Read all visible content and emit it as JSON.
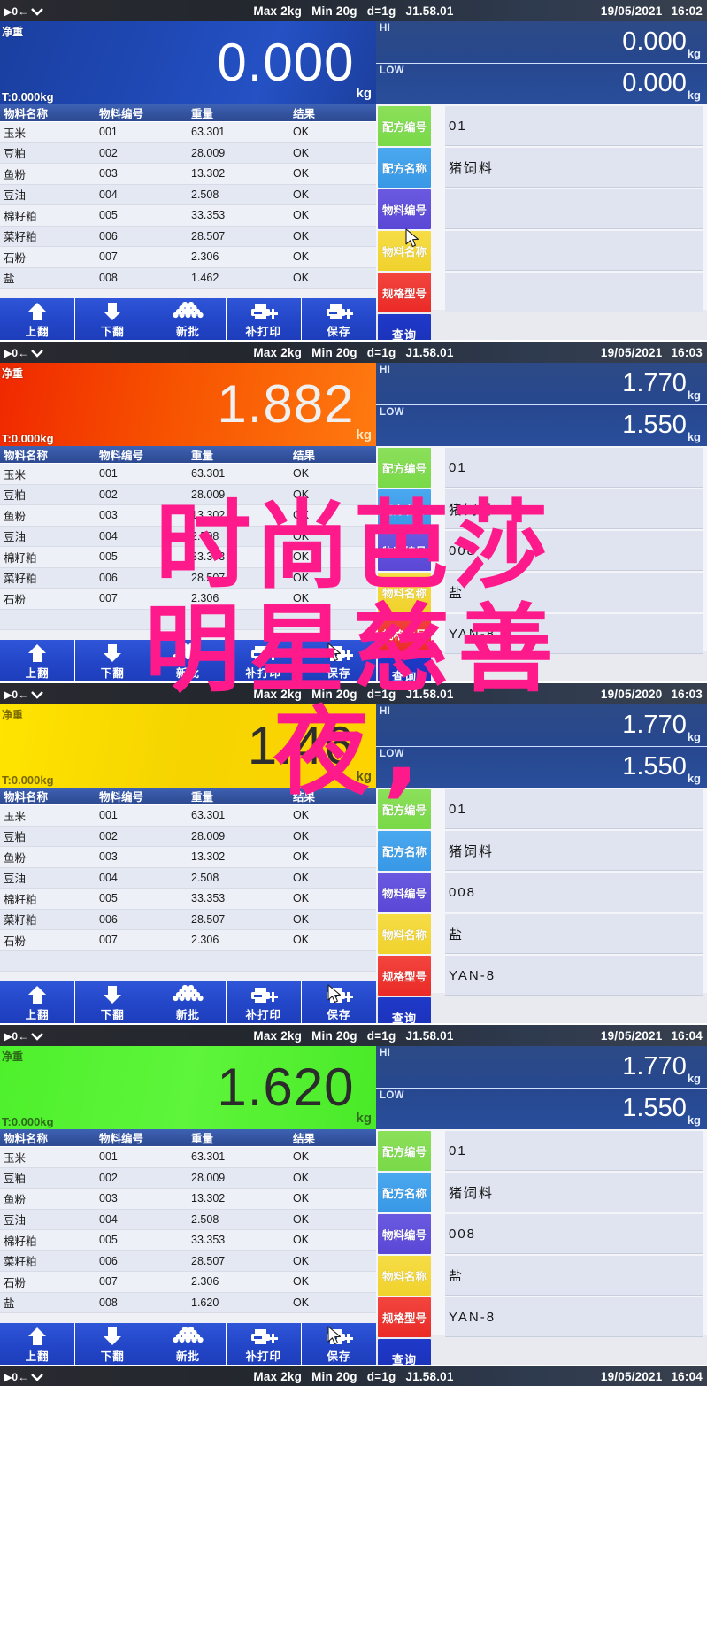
{
  "device": {
    "status_bar": {
      "zero_icon": "zero-track-icon",
      "stable_icon": "stability-icon",
      "max": "Max 2kg",
      "min": "Min 20g",
      "division": "d=1g",
      "firmware": "J1.58.01"
    },
    "labels": {
      "net": "净重",
      "tare_prefix": "T:",
      "unit": "kg",
      "hi": "HI",
      "low": "LOW"
    }
  },
  "table": {
    "headers": [
      "物料名称",
      "物料编号",
      "重量",
      "结果"
    ],
    "rows": [
      {
        "name": "玉米",
        "code": "001",
        "weight": "63.301",
        "result": "OK"
      },
      {
        "name": "豆粕",
        "code": "002",
        "weight": "28.009",
        "result": "OK"
      },
      {
        "name": "鱼粉",
        "code": "003",
        "weight": "13.302",
        "result": "OK"
      },
      {
        "name": "豆油",
        "code": "004",
        "weight": "2.508",
        "result": "OK"
      },
      {
        "name": "棉籽粕",
        "code": "005",
        "weight": "33.353",
        "result": "OK"
      },
      {
        "name": "菜籽粕",
        "code": "006",
        "weight": "28.507",
        "result": "OK"
      },
      {
        "name": "石粉",
        "code": "007",
        "weight": "2.306",
        "result": "OK"
      },
      {
        "name": "盐",
        "code": "008",
        "weight": "1.462",
        "result": "OK"
      }
    ],
    "rows_p4_last": {
      "name": "盐",
      "code": "008",
      "weight": "1.620",
      "result": "OK"
    }
  },
  "form": {
    "fields": [
      {
        "label": "配方编号",
        "color": "#79d948"
      },
      {
        "label": "配方名称",
        "color": "#3898e6"
      },
      {
        "label": "物料编号",
        "color": "#5a48d6"
      },
      {
        "label": "物料名称",
        "color": "#f0d22c"
      },
      {
        "label": "规格型号",
        "color": "#ea2a26"
      }
    ],
    "query_button": "查询"
  },
  "toolbar": {
    "buttons": [
      {
        "label": "上翻",
        "icon": "arrow-up-icon"
      },
      {
        "label": "下翻",
        "icon": "arrow-down-icon"
      },
      {
        "label": "新批",
        "icon": "stack-icon"
      },
      {
        "label": "补打印",
        "icon": "printer-plus-icon"
      },
      {
        "label": "保存",
        "icon": "printer-plus-icon"
      }
    ]
  },
  "panels": [
    {
      "id": "panel-1",
      "date": "19/05/2021",
      "time": "16:02",
      "weight": "0.000",
      "tare": "T:0.000kg",
      "hi": "0.000",
      "low": "0.000",
      "color": "blue",
      "form_values": {
        "recipe_code": "01",
        "recipe_name": "猪饲料",
        "material_code": "",
        "material_name": "",
        "spec_model": ""
      },
      "row_count": 8,
      "last_row_weight": "1.462"
    },
    {
      "id": "panel-2",
      "date": "19/05/2021",
      "time": "16:03",
      "weight": "1.882",
      "tare": "T:0.000kg",
      "hi": "1.770",
      "low": "1.550",
      "color": "orange",
      "form_values": {
        "recipe_code": "01",
        "recipe_name": "猪饲料",
        "material_code": "008",
        "material_name": "盐",
        "spec_model": "YAN-8"
      },
      "row_count": 7,
      "last_row_weight": "2.306"
    },
    {
      "id": "panel-3",
      "date": "19/05/2020",
      "time": "16:03",
      "weight": "1.46",
      "tare": "T:0.000kg",
      "hi": "1.770",
      "low": "1.550",
      "color": "yellow",
      "form_values": {
        "recipe_code": "01",
        "recipe_name": "猪饲料",
        "material_code": "008",
        "material_name": "盐",
        "spec_model": "YAN-8"
      },
      "row_count": 7,
      "last_row_weight": "2.306"
    },
    {
      "id": "panel-4",
      "date": "19/05/2021",
      "time": "16:04",
      "weight": "1.620",
      "tare": "T:0.000kg",
      "hi": "1.770",
      "low": "1.550",
      "color": "green",
      "form_values": {
        "recipe_code": "01",
        "recipe_name": "猪饲料",
        "material_code": "008",
        "material_name": "盐",
        "spec_model": "YAN-8"
      },
      "row_count": 8,
      "last_row_weight": "1.620"
    }
  ],
  "tail": {
    "date": "19/05/2021",
    "time": "16:04"
  },
  "overlay_text": {
    "line1": "时尚芭莎",
    "line2": "明星慈善",
    "line3": "夜,",
    "color": "#ff1a8c"
  }
}
